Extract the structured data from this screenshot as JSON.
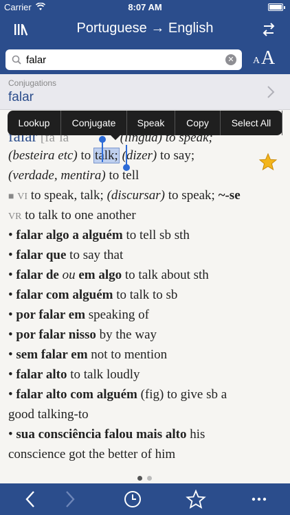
{
  "status": {
    "carrier": "Carrier",
    "time": "8:07 AM"
  },
  "nav": {
    "title": "Portuguese → English",
    "library_icon": "library-icon",
    "swap_icon": "swap-icon"
  },
  "search": {
    "value": "falar",
    "placeholder": ""
  },
  "font_size": {
    "small": "A",
    "big": "A"
  },
  "conjugations": {
    "label": "Conjugations",
    "word": "falar"
  },
  "context_menu": {
    "items": [
      "Lookup",
      "Conjugate",
      "Speak",
      "Copy",
      "Select All"
    ]
  },
  "entry": {
    "headword": "falar",
    "pron": "[faˈla",
    "l1_gloss": "(língua) to speak;",
    "l2_a": "(besteira etc)",
    "l2_b": " to ",
    "l2_sel": "talk;",
    "l2_c": " (dizer)",
    "l2_d": " to say;",
    "l3_a": "(verdade, mentira)",
    "l3_b": " to tell",
    "l4_pos": "VI",
    "l4_a": " to speak, talk; ",
    "l4_b": "(discursar)",
    "l4_c": " to speak; ",
    "l4_d": "~-se",
    "l5_pos": "VR",
    "l5_a": " to talk to one another",
    "phrases": [
      {
        "b": "falar algo a alguém",
        "t": " to tell sb sth"
      },
      {
        "b": "falar que",
        "t": " to say that"
      },
      {
        "b": "falar de ",
        "i": "ou",
        "b2": " em algo",
        "t": " to talk about sth"
      },
      {
        "b": "falar com alguém",
        "t": " to talk to sb"
      },
      {
        "b": "por falar em",
        "t": " speaking of"
      },
      {
        "b": "por falar nisso",
        "t": " by the way"
      },
      {
        "b": "sem falar em",
        "t": " not to mention"
      },
      {
        "b": "falar alto",
        "t": " to talk loudly"
      },
      {
        "b": "falar alto com alguém",
        "t": " (fig) to give sb a"
      }
    ],
    "cont1": "good talking-to",
    "p10_b": "sua consciência falou mais alto",
    "p10_t": " his",
    "cont2": "conscience got the better of him",
    "bullet": "•"
  },
  "toolbar": {
    "icons": [
      "back-icon",
      "forward-icon",
      "history-icon",
      "favorites-icon",
      "more-icon"
    ]
  },
  "colors": {
    "brand": "#2b4d8c",
    "star": "#f3b51c"
  }
}
